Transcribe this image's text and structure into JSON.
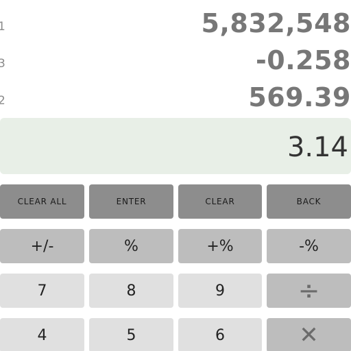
{
  "stack": [
    {
      "index": "1",
      "value": "5,832,548"
    },
    {
      "index": "3",
      "value": "-0.258"
    },
    {
      "index": "2",
      "value": "569.39"
    }
  ],
  "entry": {
    "value": "3.14"
  },
  "keys": {
    "row1": [
      "CLEAR ALL",
      "ENTER",
      "CLEAR",
      "BACK"
    ],
    "row2": [
      "+/-",
      "%",
      "+%",
      "-%"
    ],
    "row3": [
      "7",
      "8",
      "9",
      "÷"
    ],
    "row4": [
      "4",
      "5",
      "6",
      "✕"
    ]
  },
  "colors": {
    "function_key": "#8d8d8d",
    "operator_key": "#bdbdbd",
    "digit_key": "#e0e0e0",
    "entry_background": "#e8efe7",
    "stack_text": "#777777"
  }
}
